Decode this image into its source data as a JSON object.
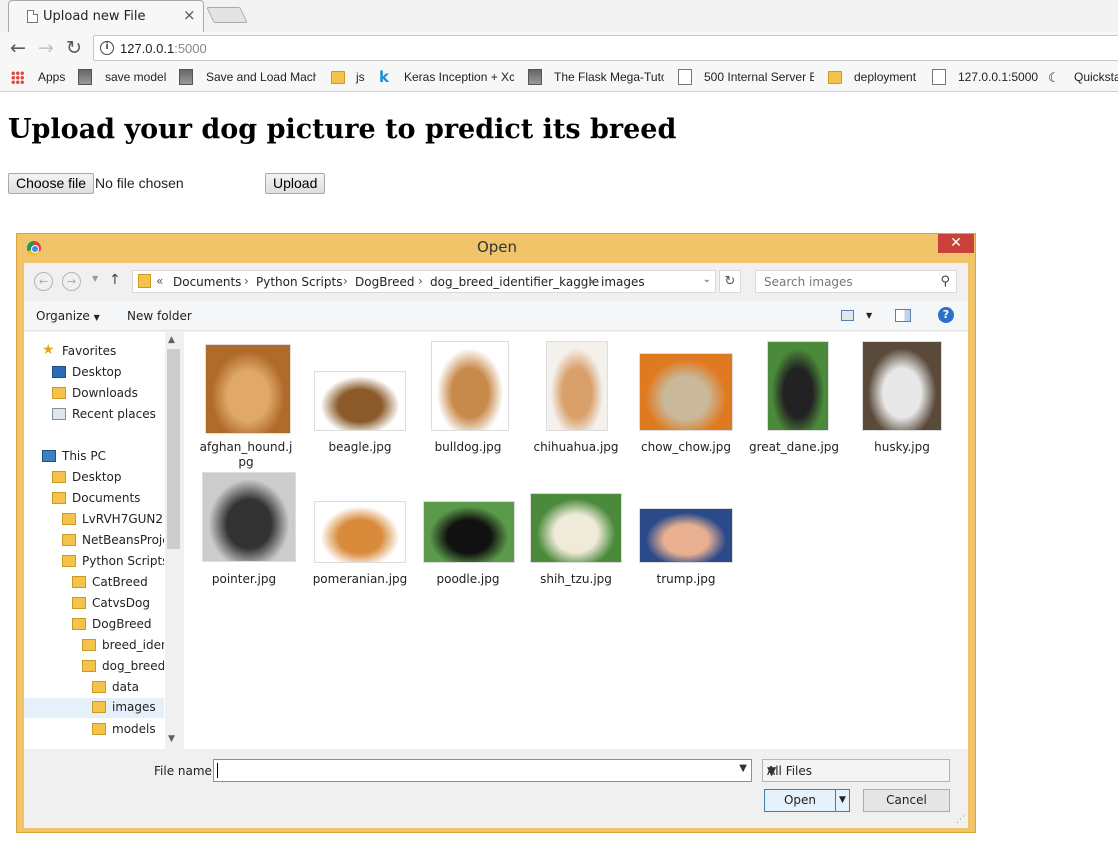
{
  "browser": {
    "tab_title": "Upload new File",
    "url_host": "127.0.0.1",
    "url_port": ":5000",
    "bookmarks": [
      {
        "label": "Apps",
        "icon": "apps-icon"
      },
      {
        "label": "save model",
        "icon": "avatar-icon"
      },
      {
        "label": "Save and Load Mach",
        "icon": "avatar-icon"
      },
      {
        "label": "js",
        "icon": "folder-icon"
      },
      {
        "label": "Keras Inception + Xc",
        "icon": "kaggle-icon"
      },
      {
        "label": "The Flask Mega-Tuto",
        "icon": "avatar-icon"
      },
      {
        "label": "500 Internal Server E",
        "icon": "page-icon"
      },
      {
        "label": "deployment",
        "icon": "folder-icon"
      },
      {
        "label": "127.0.0.1:5000",
        "icon": "page-icon"
      },
      {
        "label": "Quicksta",
        "icon": "phone-icon"
      }
    ]
  },
  "page": {
    "title": "Upload your dog picture to predict its breed",
    "choose_file": "Choose file",
    "no_file": "No file chosen",
    "upload": "Upload"
  },
  "dialog": {
    "title": "Open",
    "breadcrumb": [
      "Documents",
      "Python Scripts",
      "DogBreed",
      "dog_breed_identifier_kaggle",
      "images"
    ],
    "breadcrumb_prefix": "«",
    "search_placeholder": "Search images",
    "organize": "Organize",
    "new_folder": "New folder",
    "nav": [
      {
        "label": "Favorites"
      },
      {
        "label": "Desktop"
      },
      {
        "label": "Downloads"
      },
      {
        "label": "Recent places"
      },
      {
        "label": "This PC"
      },
      {
        "label": "Desktop"
      },
      {
        "label": "Documents"
      },
      {
        "label": "LvRVH7GUN2"
      },
      {
        "label": "NetBeansProjec"
      },
      {
        "label": "Python Scripts"
      },
      {
        "label": "CatBreed"
      },
      {
        "label": "CatvsDog"
      },
      {
        "label": "DogBreed"
      },
      {
        "label": "breed_ident"
      },
      {
        "label": "dog_breed_"
      },
      {
        "label": "data"
      },
      {
        "label": "images"
      },
      {
        "label": "models"
      }
    ],
    "files": [
      {
        "name": "afghan_hound.jpg",
        "colors": [
          "#b06a2a",
          "#e0a96a"
        ]
      },
      {
        "name": "beagle.jpg",
        "colors": [
          "#ffffff",
          "#8a5a2a"
        ]
      },
      {
        "name": "bulldog.jpg",
        "colors": [
          "#ffffff",
          "#c88a4a"
        ]
      },
      {
        "name": "chihuahua.jpg",
        "colors": [
          "#f4f0ec",
          "#d9a06a"
        ]
      },
      {
        "name": "chow_chow.jpg",
        "colors": [
          "#e07a20",
          "#c9b89a"
        ]
      },
      {
        "name": "great_dane.jpg",
        "colors": [
          "#4a8a3a",
          "#222222"
        ]
      },
      {
        "name": "husky.jpg",
        "colors": [
          "#5a4a3a",
          "#e8e8e8"
        ]
      },
      {
        "name": "pointer.jpg",
        "colors": [
          "#cccccc",
          "#333333"
        ]
      },
      {
        "name": "pomeranian.jpg",
        "colors": [
          "#ffffff",
          "#d98a3a"
        ]
      },
      {
        "name": "poodle.jpg",
        "colors": [
          "#5a9a4a",
          "#111111"
        ]
      },
      {
        "name": "shih_tzu.jpg",
        "colors": [
          "#4a8a3a",
          "#f0ead8"
        ]
      },
      {
        "name": "trump.jpg",
        "colors": [
          "#2a4a8a",
          "#e8b090"
        ]
      }
    ],
    "file_name_label": "File name:",
    "file_name_value": "",
    "file_type": "All Files",
    "open": "Open",
    "cancel": "Cancel"
  },
  "colors": {
    "dialog_frame": "#f1c46a",
    "close_button": "#c8423b",
    "selection": "#e5f0fb"
  }
}
